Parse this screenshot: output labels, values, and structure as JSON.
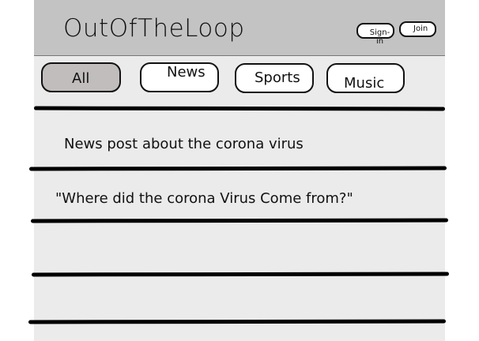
{
  "header": {
    "logo": "OutOfTheLoop",
    "signin_label": "Sign-in",
    "join_label": "Join",
    "background": "#c3c3c3"
  },
  "tabs": [
    {
      "label": "All",
      "selected": true
    },
    {
      "label": "News",
      "selected": false
    },
    {
      "label": "Sports",
      "selected": false
    },
    {
      "label": "Music",
      "selected": false
    }
  ],
  "feed": {
    "posts": [
      {
        "text": "News post about the corona virus"
      },
      {
        "text": "\"Where did the corona Virus Come from?\""
      }
    ]
  },
  "colors": {
    "page_background": "#ebebeb",
    "selected_tab": "#c2bdbd",
    "divider": "#000000"
  }
}
